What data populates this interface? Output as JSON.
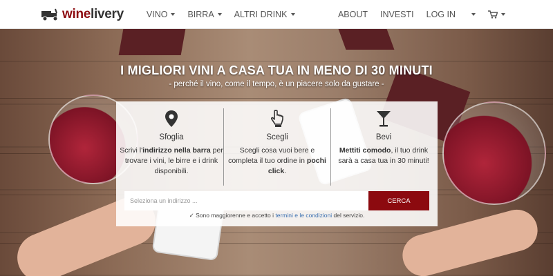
{
  "navbar": {
    "brand": {
      "part1": "wine",
      "part2": "livery"
    },
    "left_items": [
      {
        "label": "VINO",
        "has_caret": true
      },
      {
        "label": "BIRRA",
        "has_caret": true
      },
      {
        "label": "ALTRI DRINK",
        "has_caret": true
      }
    ],
    "right_items": [
      {
        "label": "ABOUT"
      },
      {
        "label": "INVESTI"
      },
      {
        "label": "LOG IN"
      }
    ],
    "cart_icon": "cart-icon"
  },
  "hero": {
    "headline": "I MIGLIORI VINI A CASA TUA IN MENO DI 30 MINUTI",
    "subline": "- perché il vino, come il tempo, è un piacere solo da gustare -"
  },
  "steps": [
    {
      "icon": "map-marker-icon",
      "title": "Sfoglia",
      "text_pre": "Scrivi l'",
      "text_bold": "indirizzo nella barra",
      "text_post": " per trovare i vini, le birre e i drink disponibili."
    },
    {
      "icon": "pointer-hand-icon",
      "title": "Scegli",
      "text_pre": "Scegli cosa vuoi bere e completa il tuo ordine in ",
      "text_bold": "pochi click",
      "text_post": "."
    },
    {
      "icon": "cocktail-glass-icon",
      "title": "Bevi",
      "text_bold": "Mettiti comodo",
      "text_post": ", il tuo drink sarà a casa tua in 30 minuti!"
    }
  ],
  "search": {
    "placeholder": "Seleziona un indirizzo ...",
    "button_label": "CERCA"
  },
  "terms": {
    "prefix": "✓ Sono maggiorenne e accetto i ",
    "link1": "termini",
    "middle": " e ",
    "link2": "le condizioni",
    "suffix": " del servizio."
  },
  "colors": {
    "brand": "#8c0a0f",
    "link": "#3a6fb0",
    "navbar_bg": "#ffffff"
  }
}
